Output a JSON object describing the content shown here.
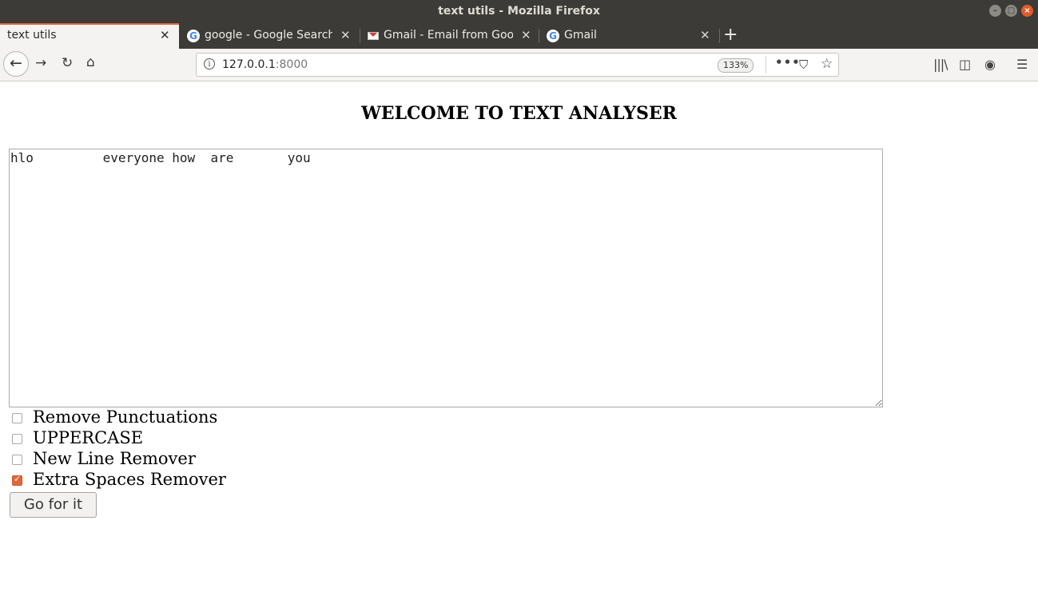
{
  "window": {
    "title": "text utils - Mozilla Firefox"
  },
  "tabs": [
    {
      "label": "text utils",
      "active": true
    },
    {
      "label": "google - Google Search",
      "active": false
    },
    {
      "label": "Gmail - Email from Goog",
      "active": false
    },
    {
      "label": "Gmail",
      "active": false
    }
  ],
  "navbar": {
    "url_host": "127.0.0.1",
    "url_port": ":8000",
    "zoom": "133%"
  },
  "page": {
    "heading": "WELCOME TO TEXT ANALYSER",
    "textarea_value": "hlo         everyone how  are       you",
    "options": [
      {
        "label": "Remove Punctuations",
        "checked": false
      },
      {
        "label": "UPPERCASE",
        "checked": false
      },
      {
        "label": "New Line Remover",
        "checked": false
      },
      {
        "label": "Extra Spaces Remover",
        "checked": true
      }
    ],
    "submit_label": "Go for it"
  },
  "colors": {
    "accent": "#e0663b",
    "titlebar": "#3c3b37"
  }
}
